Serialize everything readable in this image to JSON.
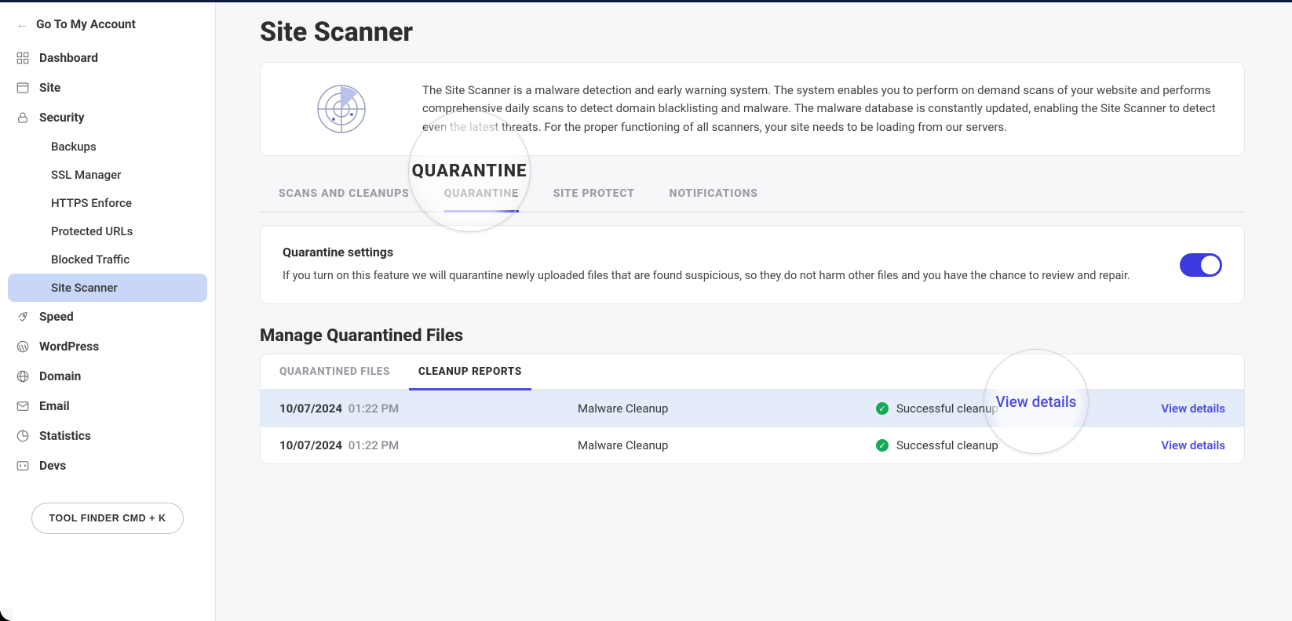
{
  "colors": {
    "accent": "#4b4be0",
    "success": "#18a957"
  },
  "sidebar": {
    "back_label": "Go To My Account",
    "items": [
      {
        "label": "Dashboard",
        "icon": "dashboard-icon"
      },
      {
        "label": "Site",
        "icon": "site-icon"
      },
      {
        "label": "Security",
        "icon": "security-icon",
        "expanded": true,
        "children": [
          {
            "label": "Backups"
          },
          {
            "label": "SSL Manager"
          },
          {
            "label": "HTTPS Enforce"
          },
          {
            "label": "Protected URLs"
          },
          {
            "label": "Blocked Traffic"
          },
          {
            "label": "Site Scanner",
            "active": true
          }
        ]
      },
      {
        "label": "Speed",
        "icon": "speed-icon"
      },
      {
        "label": "WordPress",
        "icon": "wordpress-icon"
      },
      {
        "label": "Domain",
        "icon": "domain-icon"
      },
      {
        "label": "Email",
        "icon": "email-icon"
      },
      {
        "label": "Statistics",
        "icon": "statistics-icon"
      },
      {
        "label": "Devs",
        "icon": "devs-icon"
      }
    ],
    "tool_finder_label": "TOOL FINDER CMD + K"
  },
  "page": {
    "title": "Site Scanner",
    "intro": "The Site Scanner is a malware detection and early warning system. The system enables you to perform on demand scans of your website and performs comprehensive daily scans to detect domain blacklisting and malware. The malware database is constantly updated, enabling the Site Scanner to detect even the latest threats. For the proper functioning of all scanners, your site needs to be loading from our servers."
  },
  "tabs1": [
    {
      "label": "SCANS AND CLEANUPS"
    },
    {
      "label": "QUARANTINE",
      "active": true
    },
    {
      "label": "SITE PROTECT"
    },
    {
      "label": "NOTIFICATIONS"
    }
  ],
  "quarantine_settings": {
    "title": "Quarantine settings",
    "description": "If you turn on this feature we will quarantine newly uploaded files that are found suspicious, so they do not harm other files and you have the chance to review and repair.",
    "enabled": true
  },
  "section_title": "Manage Quarantined Files",
  "tabs2": [
    {
      "label": "QUARANTINED FILES"
    },
    {
      "label": "CLEANUP REPORTS",
      "active": true
    }
  ],
  "reports": [
    {
      "date": "10/07/2024",
      "time": "01:22 PM",
      "type": "Malware Cleanup",
      "status": "Successful cleanup",
      "action": "View details"
    },
    {
      "date": "10/07/2024",
      "time": "01:22 PM",
      "type": "Malware Cleanup",
      "status": "Successful cleanup",
      "action": "View details"
    }
  ],
  "magnifiers": {
    "tab_highlight": "QUARANTINE",
    "link_highlight": "View details"
  }
}
